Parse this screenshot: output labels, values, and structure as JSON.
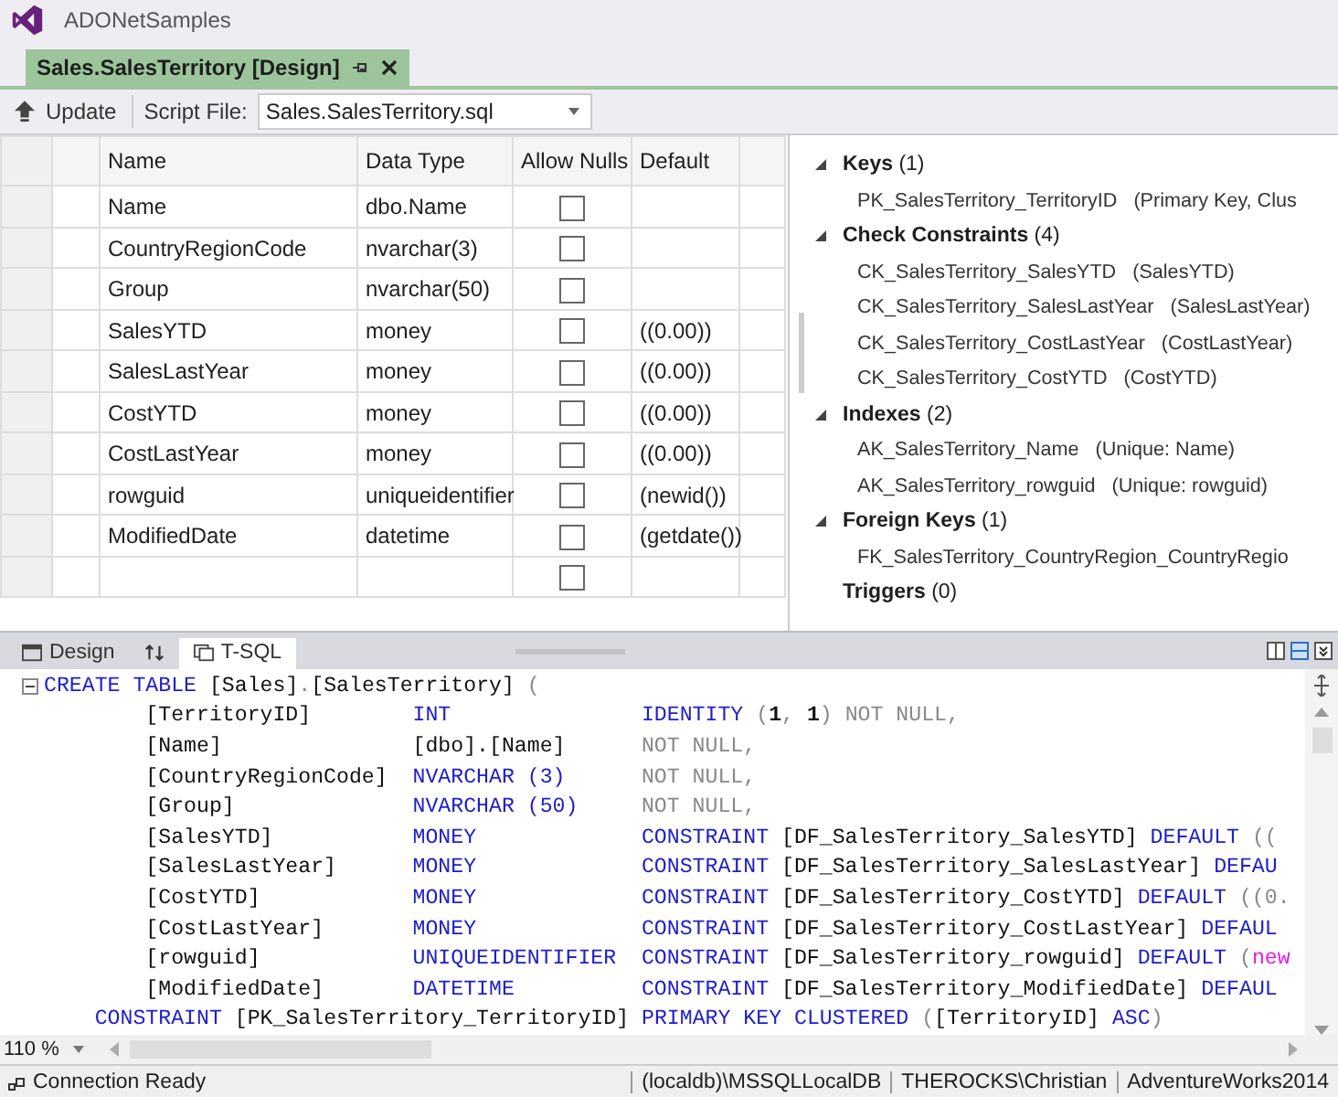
{
  "window": {
    "title": "ADONetSamples"
  },
  "document_tab": {
    "label": "Sales.SalesTerritory [Design]",
    "selected": true
  },
  "toolbar": {
    "update": "Update",
    "script_label": "Script File:",
    "script_file": "Sales.SalesTerritory.sql"
  },
  "grid": {
    "columns": [
      "Name",
      "Data Type",
      "Allow Nulls",
      "Default"
    ],
    "rows": [
      {
        "name": "Name",
        "type": "dbo.Name",
        "allow_nulls": false
      },
      {
        "name": "CountryRegionCode",
        "type": "nvarchar(3)",
        "allow_nulls": false
      },
      {
        "name": "Group",
        "type": "nvarchar(50)",
        "allow_nulls": false
      },
      {
        "name": "SalesYTD",
        "type": "money",
        "allow_nulls": false,
        "default": "((0.00))"
      },
      {
        "name": "SalesLastYear",
        "type": "money",
        "allow_nulls": false,
        "default": "((0.00))"
      },
      {
        "name": "CostYTD",
        "type": "money",
        "allow_nulls": false,
        "default": "((0.00))"
      },
      {
        "name": "CostLastYear",
        "type": "money",
        "allow_nulls": false,
        "default": "((0.00))"
      },
      {
        "name": "rowguid",
        "type": "uniqueidentifier",
        "allow_nulls": false,
        "default": "(newid())"
      },
      {
        "name": "ModifiedDate",
        "type": "datetime",
        "allow_nulls": false,
        "default": "(getdate())"
      },
      {
        "allow_nulls": false
      }
    ]
  },
  "properties": [
    {
      "name": "Keys",
      "count": "(1)",
      "expanded": true,
      "children": [
        {
          "name": "PK_SalesTerritory_TerritoryID",
          "detail": "(Primary Key, Clus"
        }
      ]
    },
    {
      "name": "Check Constraints",
      "count": "(4)",
      "expanded": true,
      "children": [
        {
          "name": "CK_SalesTerritory_SalesYTD",
          "detail": "(SalesYTD)"
        },
        {
          "name": "CK_SalesTerritory_SalesLastYear",
          "detail": "(SalesLastYear)"
        },
        {
          "name": "CK_SalesTerritory_CostLastYear",
          "detail": "(CostLastYear)"
        },
        {
          "name": "CK_SalesTerritory_CostYTD",
          "detail": "(CostYTD)"
        }
      ]
    },
    {
      "name": "Indexes",
      "count": "(2)",
      "expanded": true,
      "children": [
        {
          "name": "AK_SalesTerritory_Name",
          "detail": "(Unique: Name)"
        },
        {
          "name": "AK_SalesTerritory_rowguid",
          "detail": "(Unique: rowguid)"
        }
      ]
    },
    {
      "name": "Foreign Keys",
      "count": "(1)",
      "expanded": true,
      "children": [
        {
          "name": "FK_SalesTerritory_CountryRegion_CountryRegio"
        }
      ]
    },
    {
      "name": "Triggers",
      "count": "(0)",
      "expanded": false
    }
  ],
  "view_tabs": [
    {
      "kind": "design",
      "label": "Design",
      "selected": false
    },
    {
      "kind": "swap",
      "selected": false
    },
    {
      "kind": "tsql",
      "label": "T-SQL",
      "selected": true
    }
  ],
  "sql_lines": [
    {
      "kind": "open",
      "tokens": [
        {
          "text": "CREATE TABLE",
          "kind": "kw"
        },
        {
          "text": " [Sales]",
          "kind": "id"
        },
        {
          "text": ".",
          "kind": "gray"
        },
        {
          "text": "[SalesTerritory] ",
          "kind": "id"
        },
        {
          "text": "(",
          "kind": "gray"
        }
      ]
    },
    {
      "kind": "column",
      "name": "[TerritoryID]",
      "type": {
        "text": "INT",
        "kind": "kw"
      },
      "tokens": [
        {
          "text": "IDENTITY",
          "kind": "kw"
        },
        {
          "text": " (",
          "kind": "gray"
        },
        {
          "text": "1",
          "kind": "num"
        },
        {
          "text": ", ",
          "kind": "gray"
        },
        {
          "text": "1",
          "kind": "num"
        },
        {
          "text": ") NOT NULL,",
          "kind": "gray"
        }
      ]
    },
    {
      "kind": "column",
      "name": "[Name]",
      "type": {
        "text": "[dbo].[Name]",
        "kind": "id"
      },
      "tokens": [
        {
          "text": "NOT NULL,",
          "kind": "gray"
        }
      ]
    },
    {
      "kind": "column",
      "name": "[CountryRegionCode]",
      "type": {
        "text": "NVARCHAR (3)",
        "kind": "kw"
      },
      "tokens": [
        {
          "text": "NOT NULL,",
          "kind": "gray"
        }
      ]
    },
    {
      "kind": "column",
      "name": "[Group]",
      "type": {
        "text": "NVARCHAR (50)",
        "kind": "kw"
      },
      "tokens": [
        {
          "text": "NOT NULL,",
          "kind": "gray"
        }
      ]
    },
    {
      "kind": "column",
      "name": "[SalesYTD]",
      "type": {
        "text": "MONEY",
        "kind": "kw"
      },
      "tokens": [
        {
          "text": "CONSTRAINT",
          "kind": "kw"
        },
        {
          "text": " [DF_SalesTerritory_SalesYTD] ",
          "kind": "id"
        },
        {
          "text": "DEFAULT",
          "kind": "kw"
        },
        {
          "text": " ((",
          "kind": "gray"
        }
      ]
    },
    {
      "kind": "column",
      "name": "[SalesLastYear]",
      "type": {
        "text": "MONEY",
        "kind": "kw"
      },
      "tokens": [
        {
          "text": "CONSTRAINT",
          "kind": "kw"
        },
        {
          "text": " [DF_SalesTerritory_SalesLastYear] ",
          "kind": "id"
        },
        {
          "text": "DEFAU",
          "kind": "kw"
        }
      ]
    },
    {
      "kind": "column",
      "name": "[CostYTD]",
      "type": {
        "text": "MONEY",
        "kind": "kw"
      },
      "tokens": [
        {
          "text": "CONSTRAINT",
          "kind": "kw"
        },
        {
          "text": " [DF_SalesTerritory_CostYTD] ",
          "kind": "id"
        },
        {
          "text": "DEFAULT",
          "kind": "kw"
        },
        {
          "text": " ((0.",
          "kind": "gray"
        }
      ]
    },
    {
      "kind": "column",
      "name": "[CostLastYear]",
      "type": {
        "text": "MONEY",
        "kind": "kw"
      },
      "tokens": [
        {
          "text": "CONSTRAINT",
          "kind": "kw"
        },
        {
          "text": " [DF_SalesTerritory_CostLastYear] ",
          "kind": "id"
        },
        {
          "text": "DEFAUL",
          "kind": "kw"
        }
      ]
    },
    {
      "kind": "column",
      "name": "[rowguid]",
      "type": {
        "text": "UNIQUEIDENTIFIER",
        "kind": "kw"
      },
      "tokens": [
        {
          "text": "CONSTRAINT",
          "kind": "kw"
        },
        {
          "text": " [DF_SalesTerritory_rowguid] ",
          "kind": "id"
        },
        {
          "text": "DEFAULT",
          "kind": "kw"
        },
        {
          "text": " (",
          "kind": "gray"
        },
        {
          "text": "new",
          "kind": "fn"
        }
      ]
    },
    {
      "kind": "column",
      "name": "[ModifiedDate]",
      "type": {
        "text": "DATETIME",
        "kind": "kw"
      },
      "tokens": [
        {
          "text": "CONSTRAINT",
          "kind": "kw"
        },
        {
          "text": " [DF_SalesTerritory_ModifiedDate] ",
          "kind": "id"
        },
        {
          "text": "DEFAUL",
          "kind": "kw"
        }
      ]
    },
    {
      "kind": "body",
      "tokens": [
        {
          "text": "CONSTRAINT",
          "kind": "kw"
        },
        {
          "text": " [PK_SalesTerritory_TerritoryID] ",
          "kind": "id"
        },
        {
          "text": "PRIMARY KEY CLUSTERED",
          "kind": "kw"
        },
        {
          "text": " (",
          "kind": "gray"
        },
        {
          "text": "[TerritoryID] ",
          "kind": "id"
        },
        {
          "text": "ASC",
          "kind": "kw"
        },
        {
          "text": ")",
          "kind": "gray"
        }
      ]
    }
  ],
  "zoom": "110 %",
  "status_bar": {
    "message": "Connection Ready",
    "server": "(localdb)\\MSSQLLocalDB",
    "user": "THEROCKS\\Christian",
    "database": "AdventureWorks2014"
  }
}
